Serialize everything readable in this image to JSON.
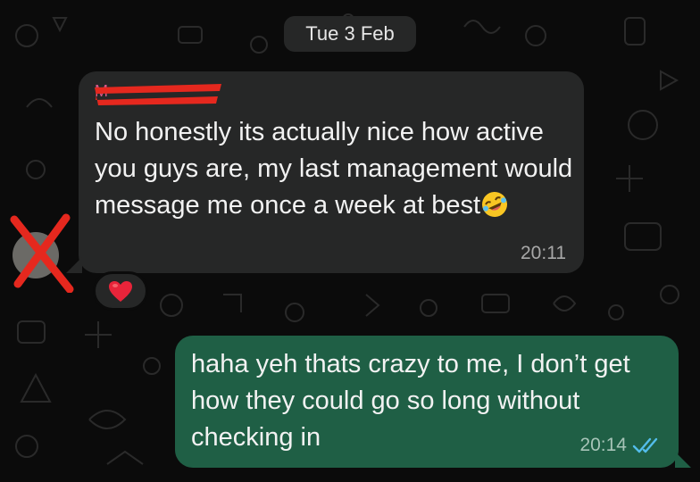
{
  "chat": {
    "date_separator": "Tue 3 Feb",
    "messages": [
      {
        "direction": "incoming",
        "sender_name": "M",
        "sender_name_redacted": true,
        "text": "No honestly its actually nice how active you guys are, my last management would message me once a week at best",
        "emoji": "rolling-on-the-floor-laughing",
        "time": "20:11",
        "reaction": "red-heart",
        "avatar_redacted": true
      },
      {
        "direction": "outgoing",
        "text": "haha yeh thats crazy to me, I don’t get how they could go so long without checking in",
        "time": "20:14",
        "status": "read"
      }
    ]
  },
  "colors": {
    "background": "#0b0b0b",
    "incoming_bubble": "#262727",
    "outgoing_bubble": "#1f5f45",
    "read_ticks": "#53bdeb",
    "redaction": "#e5281e"
  }
}
